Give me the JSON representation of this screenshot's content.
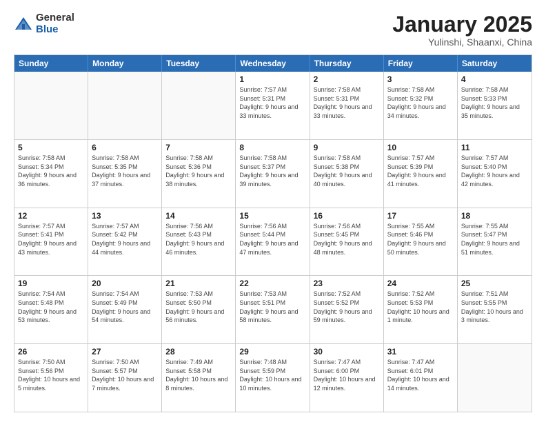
{
  "header": {
    "logo_general": "General",
    "logo_blue": "Blue",
    "month_title": "January 2025",
    "subtitle": "Yulinshi, Shaanxi, China"
  },
  "weekdays": [
    "Sunday",
    "Monday",
    "Tuesday",
    "Wednesday",
    "Thursday",
    "Friday",
    "Saturday"
  ],
  "rows": [
    [
      {
        "day": "",
        "info": ""
      },
      {
        "day": "",
        "info": ""
      },
      {
        "day": "",
        "info": ""
      },
      {
        "day": "1",
        "info": "Sunrise: 7:57 AM\nSunset: 5:31 PM\nDaylight: 9 hours and 33 minutes."
      },
      {
        "day": "2",
        "info": "Sunrise: 7:58 AM\nSunset: 5:31 PM\nDaylight: 9 hours and 33 minutes."
      },
      {
        "day": "3",
        "info": "Sunrise: 7:58 AM\nSunset: 5:32 PM\nDaylight: 9 hours and 34 minutes."
      },
      {
        "day": "4",
        "info": "Sunrise: 7:58 AM\nSunset: 5:33 PM\nDaylight: 9 hours and 35 minutes."
      }
    ],
    [
      {
        "day": "5",
        "info": "Sunrise: 7:58 AM\nSunset: 5:34 PM\nDaylight: 9 hours and 36 minutes."
      },
      {
        "day": "6",
        "info": "Sunrise: 7:58 AM\nSunset: 5:35 PM\nDaylight: 9 hours and 37 minutes."
      },
      {
        "day": "7",
        "info": "Sunrise: 7:58 AM\nSunset: 5:36 PM\nDaylight: 9 hours and 38 minutes."
      },
      {
        "day": "8",
        "info": "Sunrise: 7:58 AM\nSunset: 5:37 PM\nDaylight: 9 hours and 39 minutes."
      },
      {
        "day": "9",
        "info": "Sunrise: 7:58 AM\nSunset: 5:38 PM\nDaylight: 9 hours and 40 minutes."
      },
      {
        "day": "10",
        "info": "Sunrise: 7:57 AM\nSunset: 5:39 PM\nDaylight: 9 hours and 41 minutes."
      },
      {
        "day": "11",
        "info": "Sunrise: 7:57 AM\nSunset: 5:40 PM\nDaylight: 9 hours and 42 minutes."
      }
    ],
    [
      {
        "day": "12",
        "info": "Sunrise: 7:57 AM\nSunset: 5:41 PM\nDaylight: 9 hours and 43 minutes."
      },
      {
        "day": "13",
        "info": "Sunrise: 7:57 AM\nSunset: 5:42 PM\nDaylight: 9 hours and 44 minutes."
      },
      {
        "day": "14",
        "info": "Sunrise: 7:56 AM\nSunset: 5:43 PM\nDaylight: 9 hours and 46 minutes."
      },
      {
        "day": "15",
        "info": "Sunrise: 7:56 AM\nSunset: 5:44 PM\nDaylight: 9 hours and 47 minutes."
      },
      {
        "day": "16",
        "info": "Sunrise: 7:56 AM\nSunset: 5:45 PM\nDaylight: 9 hours and 48 minutes."
      },
      {
        "day": "17",
        "info": "Sunrise: 7:55 AM\nSunset: 5:46 PM\nDaylight: 9 hours and 50 minutes."
      },
      {
        "day": "18",
        "info": "Sunrise: 7:55 AM\nSunset: 5:47 PM\nDaylight: 9 hours and 51 minutes."
      }
    ],
    [
      {
        "day": "19",
        "info": "Sunrise: 7:54 AM\nSunset: 5:48 PM\nDaylight: 9 hours and 53 minutes."
      },
      {
        "day": "20",
        "info": "Sunrise: 7:54 AM\nSunset: 5:49 PM\nDaylight: 9 hours and 54 minutes."
      },
      {
        "day": "21",
        "info": "Sunrise: 7:53 AM\nSunset: 5:50 PM\nDaylight: 9 hours and 56 minutes."
      },
      {
        "day": "22",
        "info": "Sunrise: 7:53 AM\nSunset: 5:51 PM\nDaylight: 9 hours and 58 minutes."
      },
      {
        "day": "23",
        "info": "Sunrise: 7:52 AM\nSunset: 5:52 PM\nDaylight: 9 hours and 59 minutes."
      },
      {
        "day": "24",
        "info": "Sunrise: 7:52 AM\nSunset: 5:53 PM\nDaylight: 10 hours and 1 minute."
      },
      {
        "day": "25",
        "info": "Sunrise: 7:51 AM\nSunset: 5:55 PM\nDaylight: 10 hours and 3 minutes."
      }
    ],
    [
      {
        "day": "26",
        "info": "Sunrise: 7:50 AM\nSunset: 5:56 PM\nDaylight: 10 hours and 5 minutes."
      },
      {
        "day": "27",
        "info": "Sunrise: 7:50 AM\nSunset: 5:57 PM\nDaylight: 10 hours and 7 minutes."
      },
      {
        "day": "28",
        "info": "Sunrise: 7:49 AM\nSunset: 5:58 PM\nDaylight: 10 hours and 8 minutes."
      },
      {
        "day": "29",
        "info": "Sunrise: 7:48 AM\nSunset: 5:59 PM\nDaylight: 10 hours and 10 minutes."
      },
      {
        "day": "30",
        "info": "Sunrise: 7:47 AM\nSunset: 6:00 PM\nDaylight: 10 hours and 12 minutes."
      },
      {
        "day": "31",
        "info": "Sunrise: 7:47 AM\nSunset: 6:01 PM\nDaylight: 10 hours and 14 minutes."
      },
      {
        "day": "",
        "info": ""
      }
    ]
  ]
}
